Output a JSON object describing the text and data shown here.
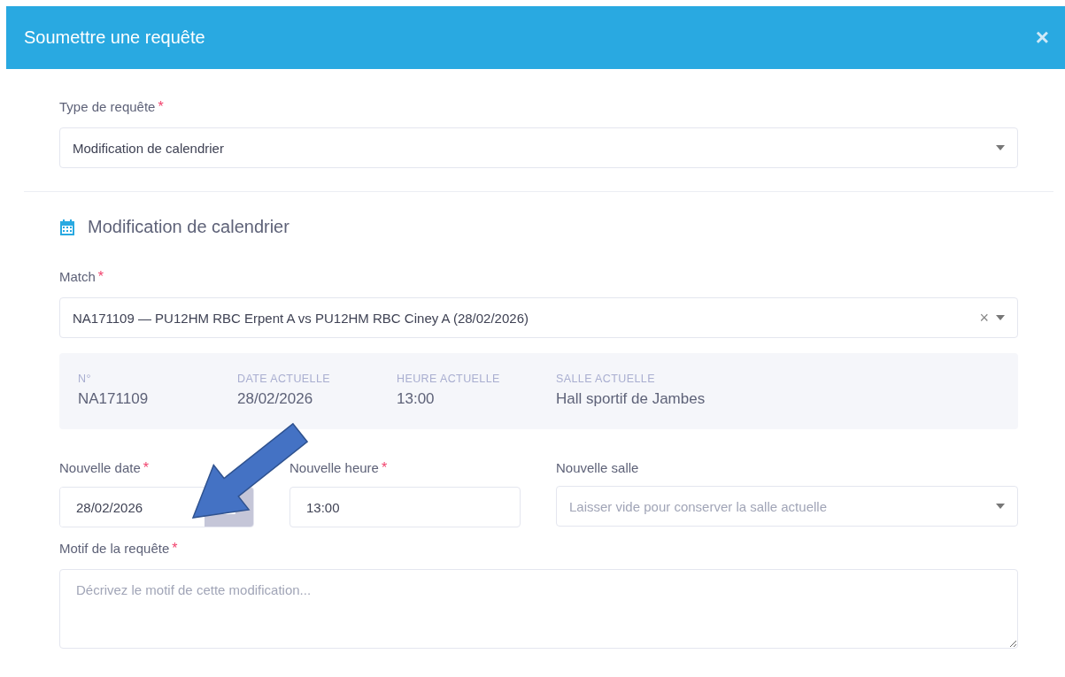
{
  "modal": {
    "title": "Soumettre une requête",
    "close": "×"
  },
  "request_type": {
    "label": "Type de requête",
    "required": "*",
    "value": "Modification de calendrier"
  },
  "section": {
    "title": "Modification de calendrier"
  },
  "match": {
    "label": "Match",
    "required": "*",
    "value": "NA171109 — PU12HM RBC Erpent A vs PU12HM RBC Ciney A (28/02/2026)",
    "clear": "×"
  },
  "current_info": [
    {
      "label": "N°",
      "value": "NA171109"
    },
    {
      "label": "DATE ACTUELLE",
      "value": "28/02/2026"
    },
    {
      "label": "HEURE ACTUELLE",
      "value": "13:00"
    },
    {
      "label": "SALLE ACTUELLE",
      "value": "Hall sportif de Jambes"
    }
  ],
  "new_fields": [
    {
      "kind": "date",
      "label": "Nouvelle date",
      "required": "*",
      "value": "28/02/2026"
    },
    {
      "kind": "time",
      "label": "Nouvelle heure",
      "required": "*",
      "value": "13:00"
    },
    {
      "kind": "select",
      "label": "Nouvelle salle",
      "placeholder": "Laisser vide pour conserver la salle actuelle"
    }
  ],
  "reason": {
    "label": "Motif de la requête",
    "required": "*",
    "placeholder": "Décrivez le motif de cette modification..."
  }
}
